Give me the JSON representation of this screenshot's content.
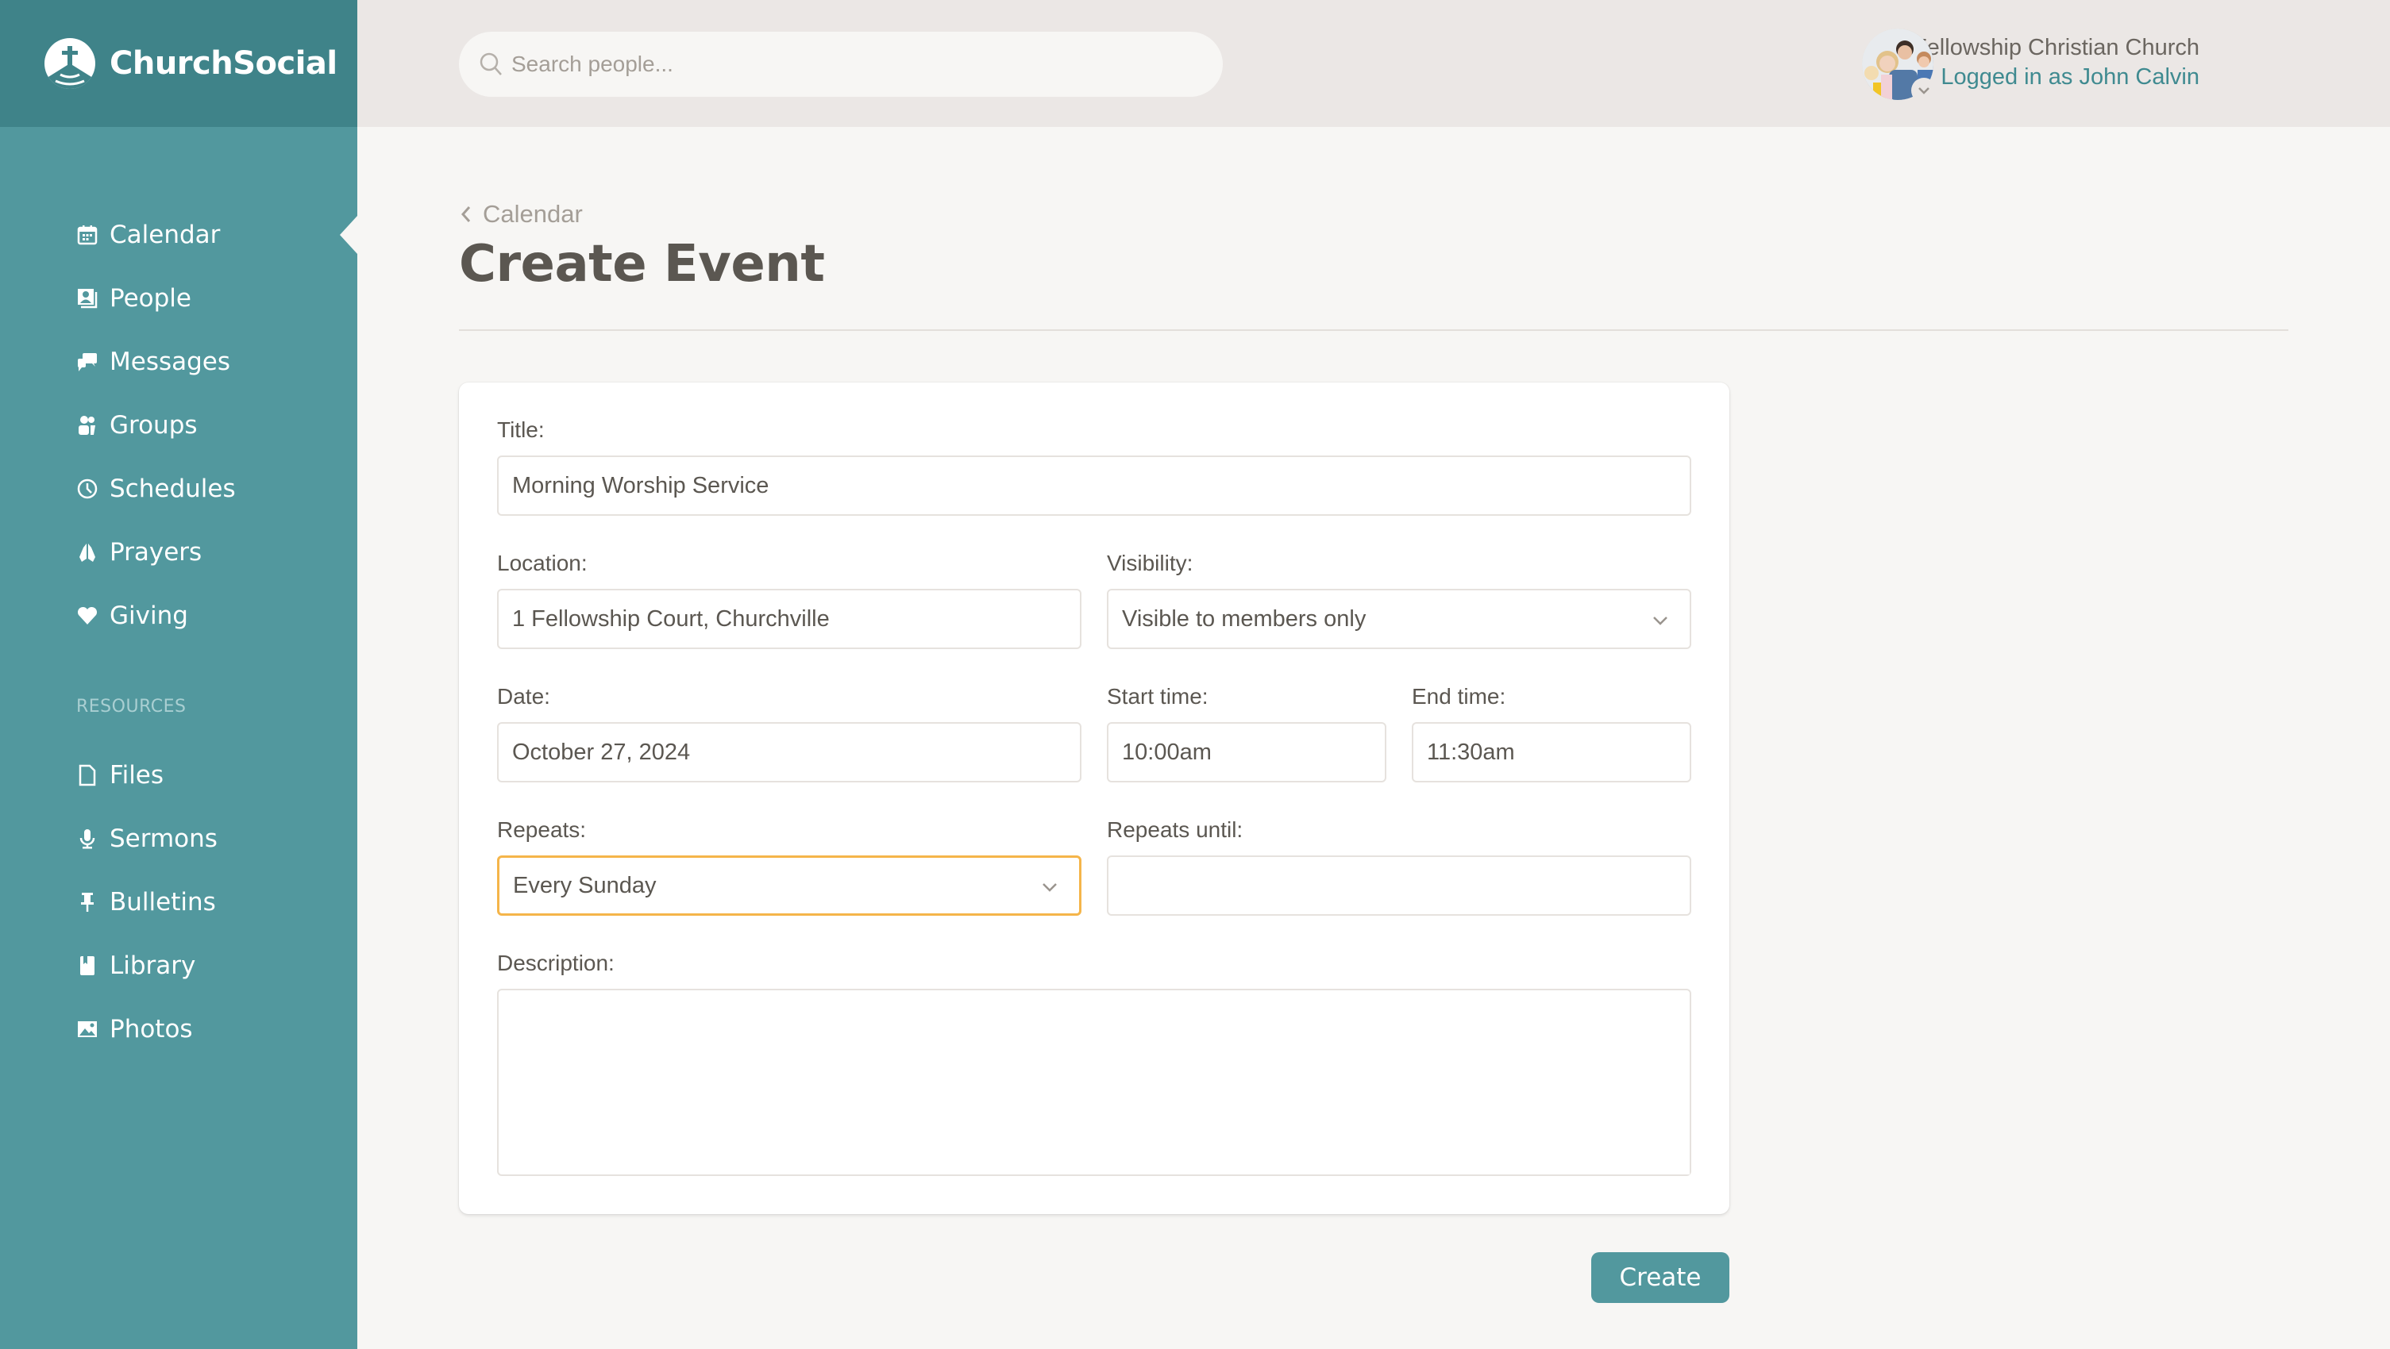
{
  "app": {
    "brand_name": "ChurchSocial",
    "accent_color": "#52989e",
    "focus_color": "#f5b54a"
  },
  "sidebar": {
    "items": [
      {
        "label": "Calendar",
        "icon": "calendar-icon",
        "active": true
      },
      {
        "label": "People",
        "icon": "person-card-icon"
      },
      {
        "label": "Messages",
        "icon": "chat-bubbles-icon"
      },
      {
        "label": "Groups",
        "icon": "group-icon"
      },
      {
        "label": "Schedules",
        "icon": "clock-icon"
      },
      {
        "label": "Prayers",
        "icon": "praying-hands-icon"
      },
      {
        "label": "Giving",
        "icon": "heart-icon"
      }
    ],
    "resources_label": "RESOURCES",
    "resources": [
      {
        "label": "Files",
        "icon": "file-icon"
      },
      {
        "label": "Sermons",
        "icon": "microphone-icon"
      },
      {
        "label": "Bulletins",
        "icon": "pushpin-icon"
      },
      {
        "label": "Library",
        "icon": "book-icon"
      },
      {
        "label": "Photos",
        "icon": "image-icon"
      }
    ]
  },
  "header": {
    "search_placeholder": "Search people...",
    "search_value": "",
    "org_name": "Fellowship Christian Church",
    "logged_in_text": "Logged in as John Calvin"
  },
  "page": {
    "breadcrumb": "Calendar",
    "title": "Create Event"
  },
  "form": {
    "title": {
      "label": "Title:",
      "value": "Morning Worship Service"
    },
    "location": {
      "label": "Location:",
      "value": "1 Fellowship Court, Churchville"
    },
    "visibility": {
      "label": "Visibility:",
      "value": "Visible to members only"
    },
    "date": {
      "label": "Date:",
      "value": "October 27, 2024"
    },
    "start_time": {
      "label": "Start time:",
      "value": "10:00am"
    },
    "end_time": {
      "label": "End time:",
      "value": "11:30am"
    },
    "repeats": {
      "label": "Repeats:",
      "value": "Every Sunday"
    },
    "repeats_until": {
      "label": "Repeats until:",
      "value": ""
    },
    "description": {
      "label": "Description:",
      "value": ""
    },
    "submit_label": "Create"
  }
}
